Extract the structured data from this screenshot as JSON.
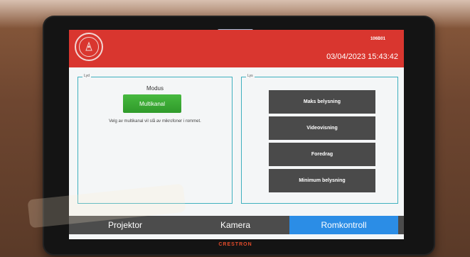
{
  "header": {
    "room_code": "106B01",
    "datetime": "03/04/2023 15:43:42",
    "logo_icon": "university-seal-icon",
    "bg_color": "#d9362f"
  },
  "lyd": {
    "legend": "Lyd",
    "modus_label": "Modus",
    "mode_button": "Multikanal",
    "info_text": "Velg av multikanal vil slå av mikrofoner i rommet."
  },
  "lys": {
    "legend": "Lys",
    "buttons": [
      "Maks belysning",
      "Videovisning",
      "Foredrag",
      "Minimum belysning"
    ]
  },
  "nav": {
    "tabs": [
      "Projektor",
      "Kamera",
      "Romkontroll"
    ],
    "active": "Romkontroll",
    "active_color": "#2b8de6"
  },
  "device": {
    "brand": "CRESTRON"
  }
}
